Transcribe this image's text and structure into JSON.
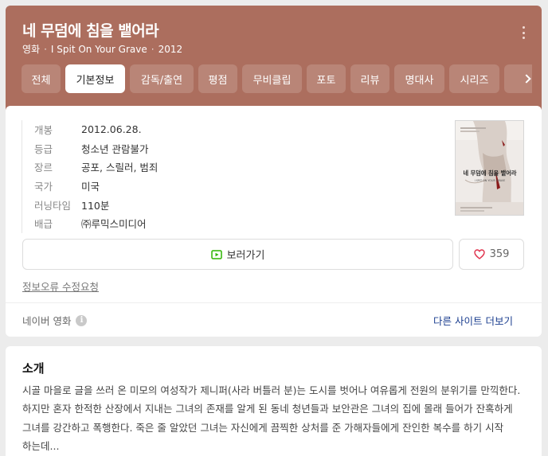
{
  "header": {
    "title": "네 무덤에 침을 뱉어라",
    "category": "영화",
    "original_title": "I Spit On Your Grave",
    "year": "2012",
    "background_color": "#ac6e5e"
  },
  "tabs": [
    {
      "label": "전체",
      "active": false
    },
    {
      "label": "기본정보",
      "active": true
    },
    {
      "label": "감독/출연",
      "active": false
    },
    {
      "label": "평점",
      "active": false
    },
    {
      "label": "무비클립",
      "active": false
    },
    {
      "label": "포토",
      "active": false
    },
    {
      "label": "리뷰",
      "active": false
    },
    {
      "label": "명대사",
      "active": false
    },
    {
      "label": "시리즈",
      "active": false
    }
  ],
  "info": [
    {
      "key": "개봉",
      "value": "2012.06.28."
    },
    {
      "key": "등급",
      "value": "청소년 관람불가"
    },
    {
      "key": "장르",
      "value": "공포, 스릴러, 범죄"
    },
    {
      "key": "국가",
      "value": "미국"
    },
    {
      "key": "러닝타임",
      "value": "110분"
    },
    {
      "key": "배급",
      "value": "㈜루믹스미디어"
    }
  ],
  "poster": {
    "title_text": "네 무덤에 침을 뱉어라",
    "subtitle_text": "I SPIT ON YOUR GRAVE"
  },
  "actions": {
    "watch_label": "보러가기",
    "like_count": "359"
  },
  "links": {
    "report": "정보오류 수정요청",
    "source": "네이버 영화",
    "info_icon_glyph": "i",
    "other_sites": "다른 사이트 더보기"
  },
  "synopsis": {
    "title": "소개",
    "text": "시골 마을로 글을 쓰러 온 미모의 여성작가 제니퍼(사라 버틀러 분)는 도시를 벗어나 여유롭게 전원의 분위기를 만끽한다. 하지만 혼자 한적한 산장에서 지내는 그녀의 존재를 알게 된 동네 청년들과 보안관은 그녀의 집에 몰래 들어가 잔혹하게 그녀를 강간하고 폭행한다. 죽은 줄 알았던 그녀는 자신에게 끔찍한 상처를 준 가해자들에게 잔인한 복수를 하기 시작 하는데..."
  },
  "colors": {
    "link_blue": "#1a3d8f",
    "watch_icon_green": "#2db400",
    "heart_red": "#e0354f"
  }
}
